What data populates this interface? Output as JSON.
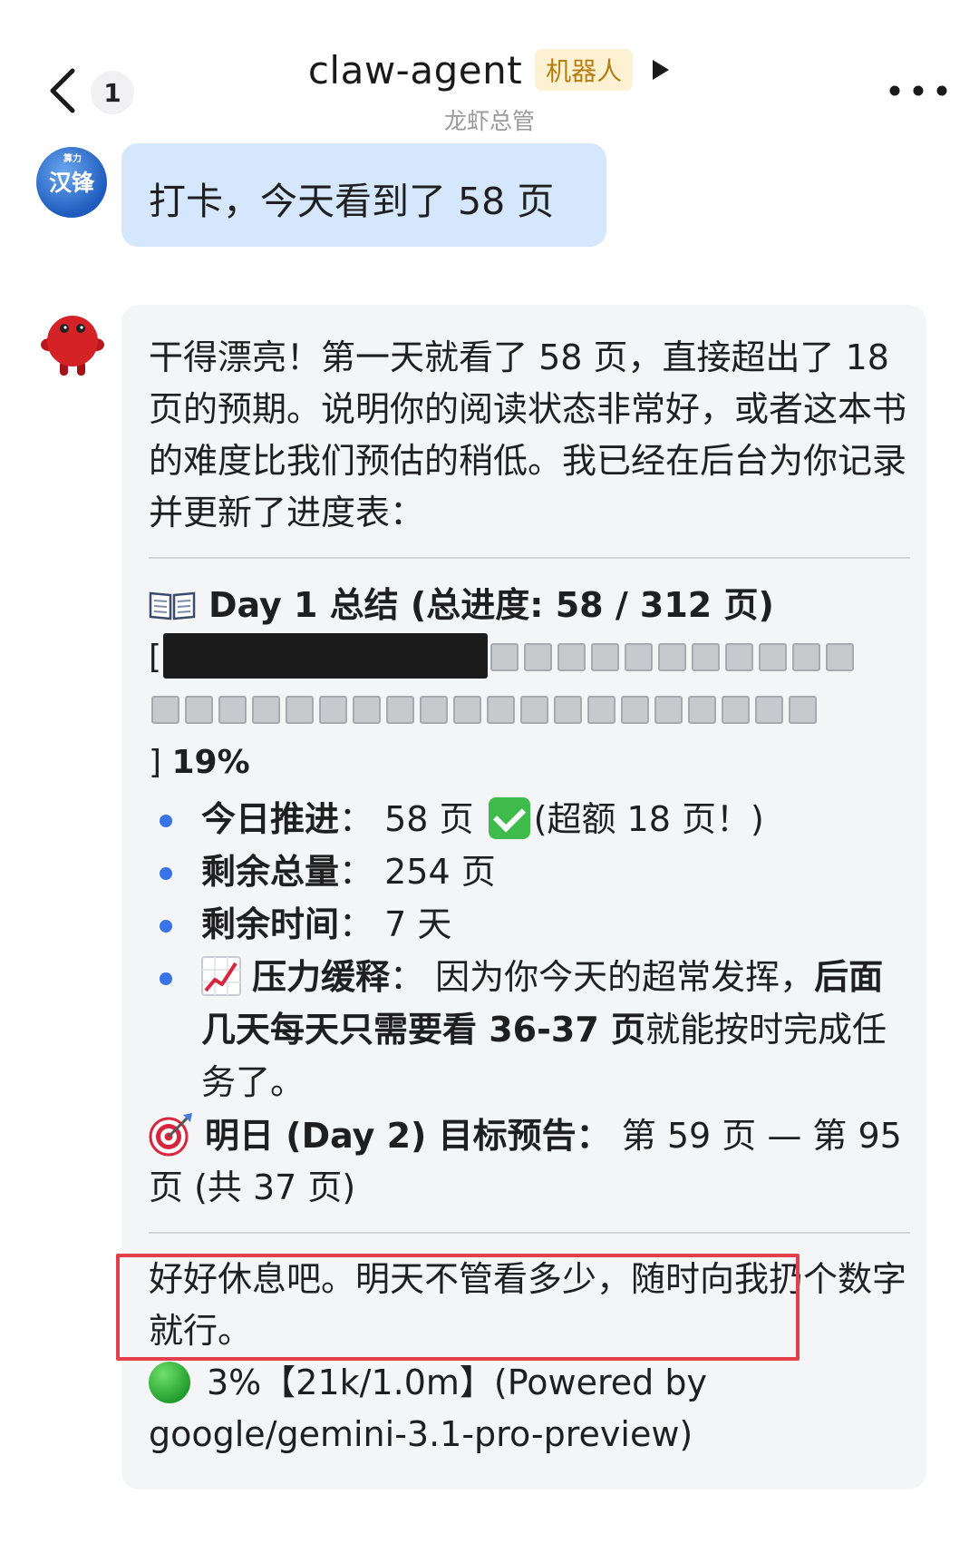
{
  "header": {
    "unread_count": "1",
    "title": "claw-agent",
    "badge": "机器人",
    "subtitle": "龙虾总管"
  },
  "user": {
    "avatar_text": "汉锋",
    "avatar_top_text": "算力",
    "message": "打卡，今天看到了 58 页"
  },
  "bot": {
    "intro": "干得漂亮！第一天就看了 58 页，直接超出了 18 页的预期。说明你的阅读状态非常好，或者这本书的难度比我们预估的稍低。我已经在后台为你记录并更新了进度表：",
    "summary_title": "Day 1 总结 (总进度: 58 / 312 页)",
    "progress": {
      "open_bracket": "[",
      "close_bracket": "]",
      "percent_label": "19%",
      "fraction": 0.19
    },
    "stats": [
      {
        "label": "今日推进",
        "sep": "：",
        "value": "58 页",
        "extra": "(超额 18 页！)"
      },
      {
        "label": "剩余总量",
        "sep": "：",
        "value": "254 页"
      },
      {
        "label": "剩余时间",
        "sep": "：",
        "value": "7 天"
      },
      {
        "label": "压力缓释",
        "sep": "：",
        "pre": "因为你今天的超常发挥，",
        "bold": "后面几天每天只需要看 36-37 页",
        "post": "就能按时完成任务了。"
      }
    ],
    "tomorrow": {
      "label": "明日 (Day 2) 目标预告",
      "sep": "：",
      "value": " 第 59 页 — 第 95 页 (共 37 页)"
    },
    "closing": "好好休息吧。明天不管看多少，随时向我扔个数字就行。",
    "footer": "3%【21k/1.0m】(Powered by google/gemini-3.1-pro-preview)"
  },
  "colors": {
    "user_bubble": "#d5e7fd",
    "bot_card": "#f4f5f7",
    "badge_bg": "#fdf1d3",
    "badge_text": "#b47f10",
    "bullet": "#3a73e6",
    "highlight_border": "#e4404b"
  },
  "icons": [
    "back-icon",
    "play-icon",
    "more-icon",
    "book-icon",
    "check-icon",
    "chart-up-icon",
    "target-icon",
    "green-circle-icon"
  ]
}
